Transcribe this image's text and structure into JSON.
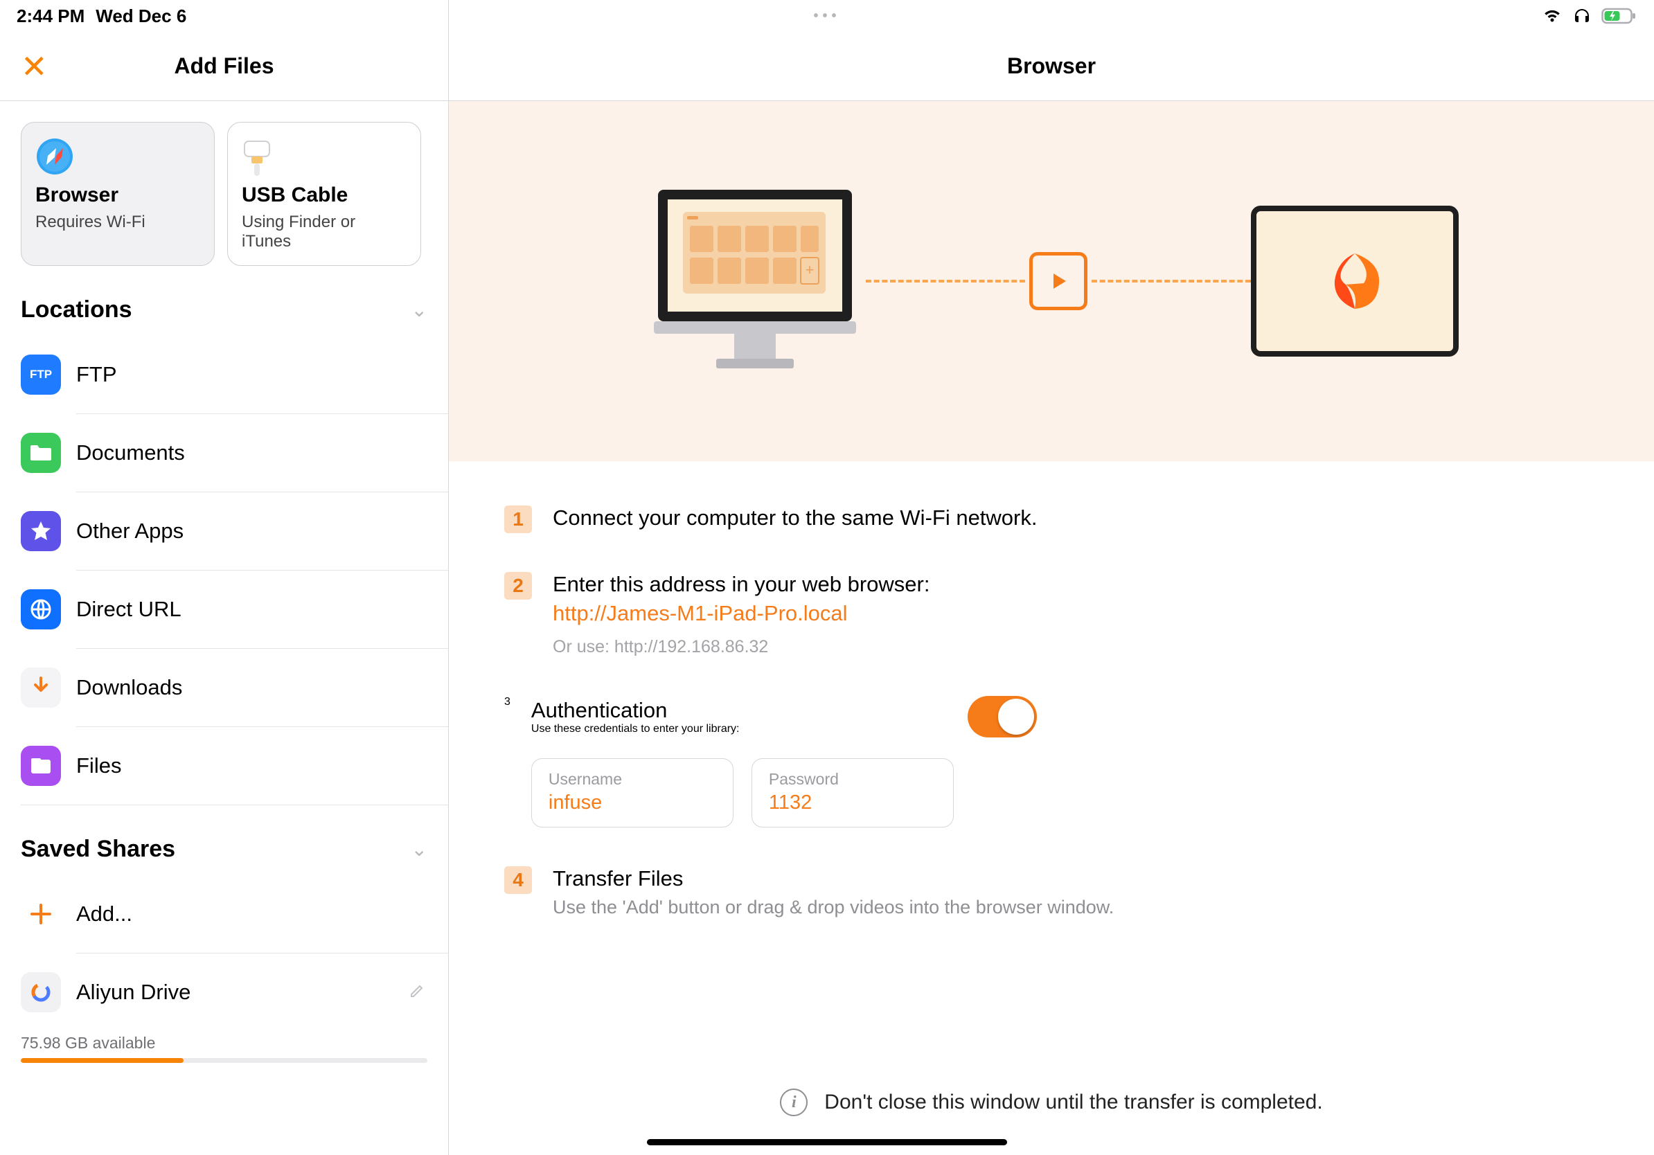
{
  "status": {
    "time": "2:44 PM",
    "date": "Wed Dec 6"
  },
  "sidebar": {
    "title": "Add Files",
    "cards": {
      "browser": {
        "title": "Browser",
        "sub": "Requires Wi-Fi"
      },
      "usb": {
        "title": "USB Cable",
        "sub": "Using Finder or iTunes"
      }
    },
    "locations_label": "Locations",
    "locations": {
      "ftp": "FTP",
      "documents": "Documents",
      "other_apps": "Other Apps",
      "direct_url": "Direct URL",
      "downloads": "Downloads",
      "files": "Files"
    },
    "saved_shares_label": "Saved Shares",
    "add_label": "Add...",
    "shares": {
      "aliyun": "Aliyun Drive"
    },
    "storage": {
      "available_text": "75.98 GB available",
      "fill_percent": 40
    }
  },
  "main": {
    "title": "Browser",
    "steps": {
      "s1": "Connect your computer to the same Wi-Fi network.",
      "s2": {
        "text": "Enter this address in your web browser:",
        "url": "http://James-M1-iPad-Pro.local",
        "alt": "Or use: http://192.168.86.32"
      },
      "s3": {
        "title": "Authentication",
        "sub": "Use these credentials to enter your library:",
        "username_label": "Username",
        "username": "infuse",
        "password_label": "Password",
        "password": "1132"
      },
      "s4": {
        "title": "Transfer Files",
        "sub": "Use the 'Add' button or drag & drop videos into the browser window."
      }
    },
    "notice": "Don't close this window until the transfer is completed."
  }
}
